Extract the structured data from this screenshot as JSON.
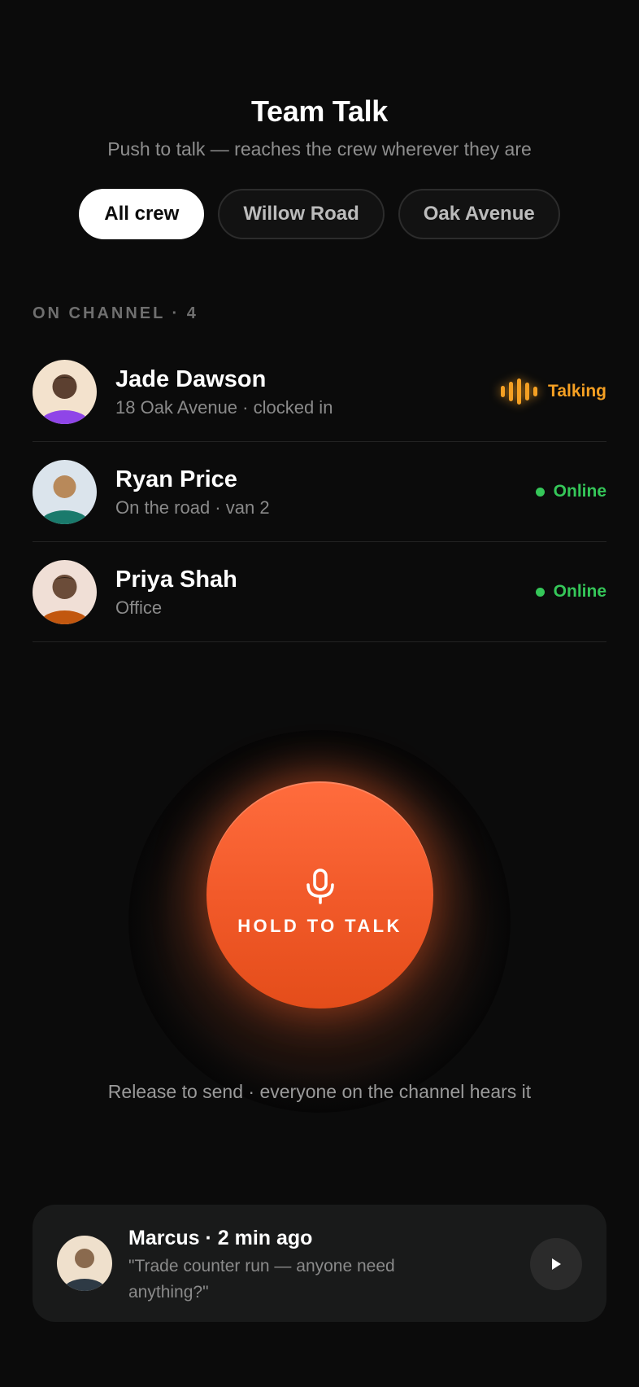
{
  "header": {
    "title": "Team Talk",
    "subtitle": "Push to talk — reaches the crew wherever they are"
  },
  "channels": {
    "selected": "All crew",
    "items": [
      {
        "label": "All crew"
      },
      {
        "label": "Willow Road"
      },
      {
        "label": "Oak Avenue"
      }
    ]
  },
  "section": {
    "label": "ON CHANNEL · 4"
  },
  "members": [
    {
      "name": "Jade Dawson",
      "detail": "18 Oak Avenue · clocked in",
      "status": "Talking",
      "status_color": "#f5a023"
    },
    {
      "name": "Ryan Price",
      "detail": "On the road · van 2",
      "status": "Online",
      "status_color": "#35c759"
    },
    {
      "name": "Priya Shah",
      "detail": "Office",
      "status": "Online",
      "status_color": "#35c759"
    }
  ],
  "ptt": {
    "label": "HOLD TO TALK",
    "icon": "microphone-icon",
    "color": "#f25a2a",
    "hint": "Release to send · everyone on the channel hears it"
  },
  "last_message": {
    "title": "Marcus · 2 min ago",
    "quote": "\"Trade counter run — anyone need anything?\"",
    "play_icon": "play-icon"
  }
}
